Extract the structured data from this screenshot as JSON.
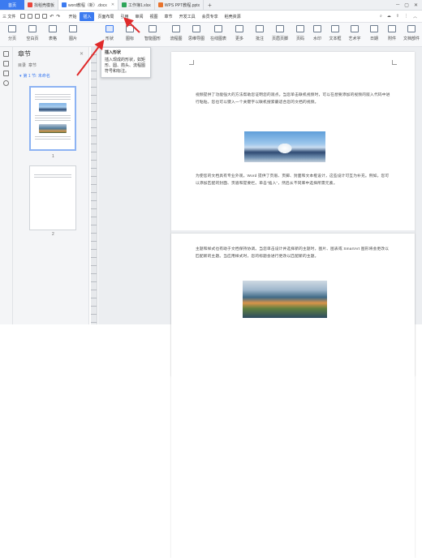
{
  "tabbar": {
    "home": "首页",
    "tabs": [
      {
        "label": "找稻壳模板",
        "color": "#e8453c"
      },
      {
        "label": "word教程（新）.docx",
        "color": "#3c7bf0",
        "active": true
      },
      {
        "label": "工作簿1.xlsx",
        "color": "#2ea55a"
      },
      {
        "label": "WPS PPT教程.pptx",
        "color": "#e8732c"
      }
    ]
  },
  "menubar": {
    "file": "三 文件",
    "items": [
      "开始",
      "插入",
      "页面布局",
      "引用",
      "审阅",
      "视图",
      "章节",
      "开发工具",
      "会员专享",
      "稻壳资源"
    ],
    "active_index": 1
  },
  "ribbon": {
    "items": [
      "分页",
      "空白页",
      "表格",
      "图片",
      "形状",
      "图标",
      "智能图形",
      "流程图",
      "思维导图",
      "在线图表",
      "更多",
      "批注",
      "页眉页脚",
      "页码",
      "水印",
      "文本框",
      "艺术字",
      "日期",
      "附件",
      "文档部件"
    ],
    "highlight_index": 4
  },
  "tooltip": {
    "title": "插入形状",
    "body": "插入现成的形状，如矩形、圆、箭头、流程图符号和标注。"
  },
  "navpane": {
    "title": "章节",
    "sub_tabs": [
      "目录",
      "章节"
    ],
    "section": "第 1 节: 未命名",
    "pages": [
      "1",
      "2"
    ]
  },
  "document": {
    "para1": "视频提供了功能强大的方法帮助您证明您的观点。当您单击联机视频时，可以在想要添加的视频的嵌入代码中进行粘贴。您也可以键入一个关键字以联机搜索最适合您的文档的视频。",
    "para2": "为使您的文档具有专业外观，Word 提供了页眉、页脚、封面和文本框设计，这些设计可互为补充。例如，您可以添加匹配的封面、页眉和提要栏。单击“插入”，然后从不同库中选择所需元素。",
    "para3": "主题和样式也有助于文档保持协调。当您单击设计并选择新的主题时，图片、图表或 SmartArt 图形将会更改以匹配新的主题。当应用样式时，您的标题会进行更改以匹配新的主题。"
  }
}
